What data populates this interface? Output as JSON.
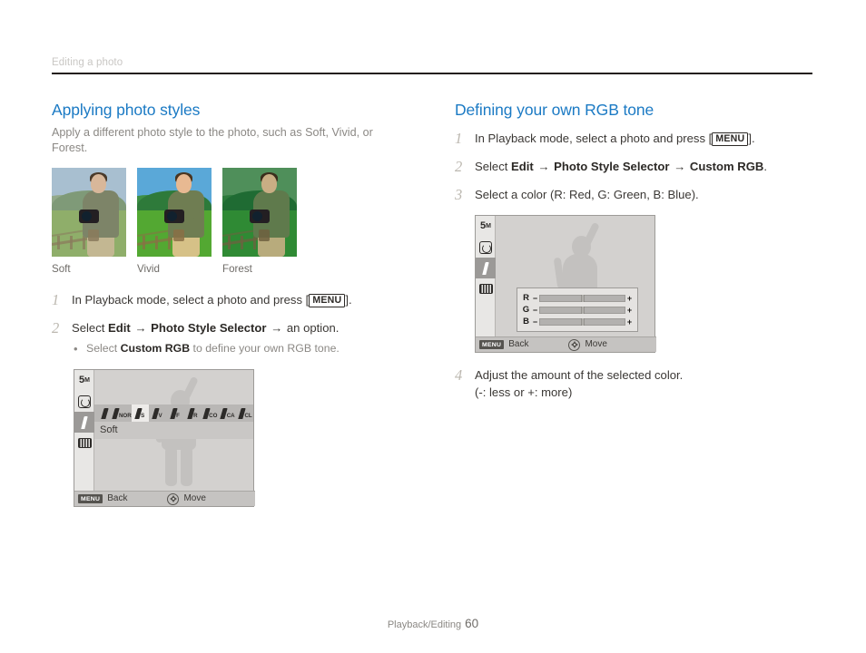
{
  "header": {
    "running_title": "Editing a photo"
  },
  "left_column": {
    "title": "Applying photo styles",
    "intro": "Apply a different photo style to the photo, such as Soft, Vivid, or Forest.",
    "thumbnails": [
      {
        "caption": "Soft",
        "sky": "#a8bfd0",
        "hills": "#7f9a78",
        "hills2": "#93a98a",
        "field": "#8fae6a",
        "skin": "#d8b79a",
        "hair": "#4a3a2a",
        "vest": "#7d8468",
        "pants": "#c3b792",
        "fence": "#8a7a5c"
      },
      {
        "caption": "Vivid",
        "sky": "#5aa8d8",
        "hills": "#2e7a3a",
        "hills2": "#3d8f45",
        "field": "#53a832",
        "skin": "#e8b992",
        "hair": "#4a3520",
        "vest": "#6f7d52",
        "pants": "#d6c187",
        "fence": "#8a6f45"
      },
      {
        "caption": "Forest",
        "sky": "#4f8f5a",
        "hills": "#1f6b33",
        "hills2": "#2d7a3c",
        "field": "#2f8a34",
        "skin": "#c9ae84",
        "hair": "#3a2e1c",
        "vest": "#5f7a4c",
        "pants": "#b8ab7c",
        "fence": "#6f6040"
      }
    ],
    "steps": [
      {
        "num": "1",
        "pre": "In Playback mode, select a photo and press [",
        "key": "MENU",
        "post": "]."
      },
      {
        "num": "2",
        "select_word": "Select",
        "bold1": "Edit",
        "arrow": "→",
        "bold2": "Photo Style Selector",
        "tail": "an option.",
        "substep": {
          "bullet": "•",
          "pre": "Select ",
          "bold": "Custom RGB",
          "post": " to define your own RGB tone."
        }
      }
    ],
    "lcd": {
      "resolution": "5",
      "resolution_unit": "M",
      "sidebar_icons": [
        "resolution-5m-icon",
        "rotate-icon",
        "brush-icon",
        "film-icon"
      ],
      "active_sidebar_index": 2,
      "style_icons": [
        {
          "label": "",
          "selected": false
        },
        {
          "label": "NOR",
          "selected": false
        },
        {
          "label": "S",
          "selected": true
        },
        {
          "label": "V",
          "selected": false
        },
        {
          "label": "F",
          "selected": false
        },
        {
          "label": "R",
          "selected": false
        },
        {
          "label": "CO",
          "selected": false
        },
        {
          "label": "CA",
          "selected": false
        },
        {
          "label": "CL",
          "selected": false
        }
      ],
      "more_arrow": "›",
      "selected_style_name": "Soft",
      "bottom_bar": {
        "menu_badge": "MENU",
        "back_label": "Back",
        "move_label": "Move"
      }
    }
  },
  "right_column": {
    "title": "Defining your own RGB tone",
    "steps": [
      {
        "num": "1",
        "pre": "In Playback mode, select a photo and press [",
        "key": "MENU",
        "post": "]."
      },
      {
        "num": "2",
        "select_word": "Select",
        "bold1": "Edit",
        "arrow": "→",
        "bold2": "Photo Style Selector",
        "bold3": "Custom RGB",
        "tail": "."
      },
      {
        "num": "3",
        "text": "Select a color (R: Red, G: Green, B: Blue)."
      },
      {
        "num": "4",
        "text": "Adjust the amount of the selected color.",
        "sub": "(-: less or +: more)"
      }
    ],
    "lcd": {
      "resolution": "5",
      "resolution_unit": "M",
      "sidebar_icons": [
        "resolution-5m-icon",
        "rotate-icon",
        "brush-icon",
        "film-icon"
      ],
      "active_sidebar_index": 2,
      "rgb_sliders": [
        {
          "label": "R",
          "minus": "−",
          "plus": "+",
          "value": 50
        },
        {
          "label": "G",
          "minus": "−",
          "plus": "+",
          "value": 50
        },
        {
          "label": "B",
          "minus": "−",
          "plus": "+",
          "value": 50
        }
      ],
      "bottom_bar": {
        "menu_badge": "MENU",
        "back_label": "Back",
        "move_label": "Move"
      }
    }
  },
  "footer": {
    "section": "Playback/Editing",
    "page_number": "60"
  },
  "colors": {
    "heading_blue": "#1b7ac4",
    "body_text": "#3b3835",
    "muted_text": "#8b8884",
    "rule": "#231f1c",
    "step_number": "#bcb8b0"
  }
}
